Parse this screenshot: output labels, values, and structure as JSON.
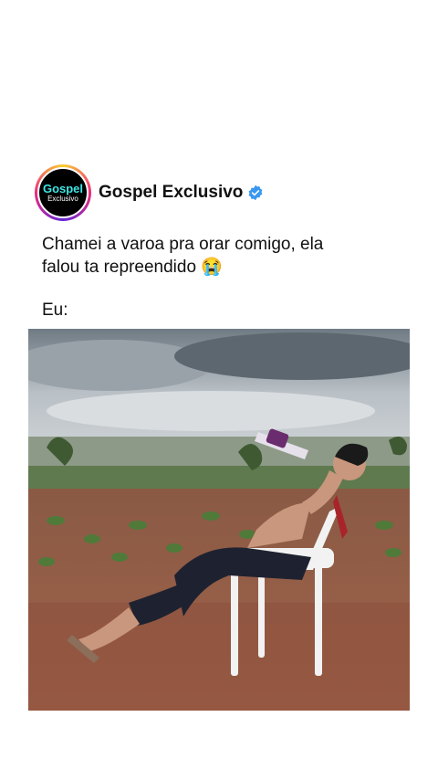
{
  "post": {
    "account_name": "Gospel Exclusivo",
    "verified": true,
    "avatar": {
      "logo_top": "Gospel",
      "logo_bottom": "Exclusivo"
    },
    "caption_line1": "Chamei a varoa pra orar comigo, ela",
    "caption_line2": "falou ta repreendido 😭",
    "caption_line3": "Eu:"
  },
  "colors": {
    "verified_blue": "#3897f0",
    "logo_cyan": "#3ee6e6"
  },
  "photo": {
    "description_icon": "man-drinking-soda-on-plastic-chair-photo"
  }
}
